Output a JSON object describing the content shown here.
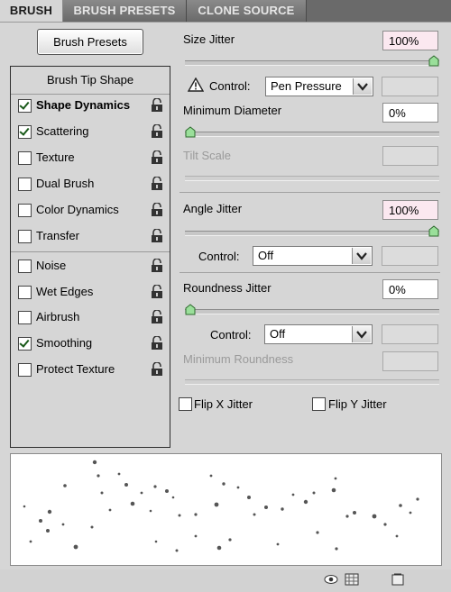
{
  "tabs": [
    {
      "label": "BRUSH",
      "active": true
    },
    {
      "label": "BRUSH PRESETS",
      "active": false
    },
    {
      "label": "CLONE SOURCE",
      "active": false
    }
  ],
  "presets_button": "Brush Presets",
  "list": {
    "header": "Brush Tip Shape",
    "items": [
      {
        "label": "Shape Dynamics",
        "checked": true,
        "selected": true
      },
      {
        "label": "Scattering",
        "checked": true
      },
      {
        "label": "Texture",
        "checked": false
      },
      {
        "label": "Dual Brush",
        "checked": false
      },
      {
        "label": "Color Dynamics",
        "checked": false
      },
      {
        "label": "Transfer",
        "checked": false
      },
      {
        "label": "Noise",
        "checked": false
      },
      {
        "label": "Wet Edges",
        "checked": false
      },
      {
        "label": "Airbrush",
        "checked": false
      },
      {
        "label": "Smoothing",
        "checked": true
      },
      {
        "label": "Protect Texture",
        "checked": false
      }
    ]
  },
  "size_jitter": {
    "label": "Size Jitter",
    "value": "100%",
    "level": 1.0
  },
  "control1": {
    "label": "Control:",
    "value": "Pen Pressure"
  },
  "min_diameter": {
    "label": "Minimum Diameter",
    "value": "0%",
    "level": 0.0
  },
  "tilt_scale": {
    "label": "Tilt Scale"
  },
  "angle_jitter": {
    "label": "Angle Jitter",
    "value": "100%",
    "level": 1.0
  },
  "control2": {
    "label": "Control:",
    "value": "Off"
  },
  "roundness_jitter": {
    "label": "Roundness Jitter",
    "value": "0%",
    "level": 0.0
  },
  "control3": {
    "label": "Control:",
    "value": "Off"
  },
  "min_roundness": {
    "label": "Minimum Roundness"
  },
  "flip_x": {
    "label": "Flip X Jitter",
    "checked": false
  },
  "flip_y": {
    "label": "Flip Y Jitter",
    "checked": false
  },
  "colors": {
    "panel": "#d6d6d6",
    "tab_bar": "#6a6a6a",
    "pink_field": "#fbe8f0",
    "check": "#1a5a1a"
  }
}
